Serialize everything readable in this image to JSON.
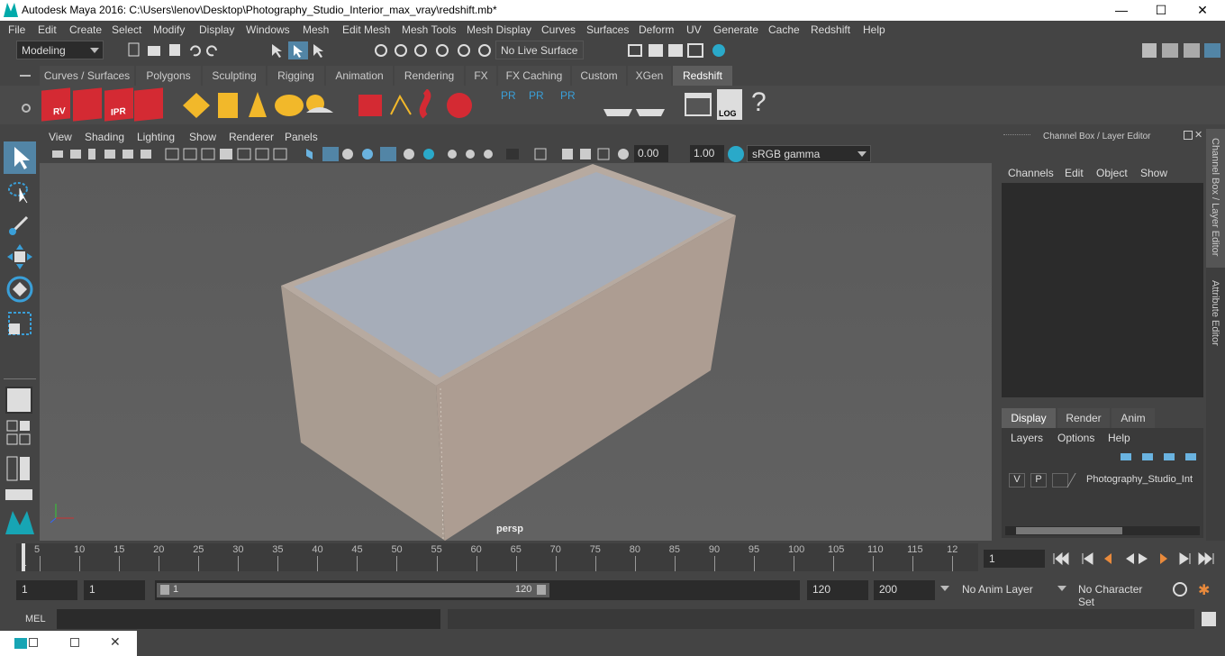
{
  "window": {
    "title": "Autodesk Maya 2016: C:\\Users\\lenov\\Desktop\\Photography_Studio_Interior_max_vray\\redshift.mb*",
    "minimize": "—",
    "maximize": "☐",
    "close": "✕"
  },
  "menu": [
    "File",
    "Edit",
    "Create",
    "Select",
    "Modify",
    "Display",
    "Windows",
    "Mesh",
    "Edit Mesh",
    "Mesh Tools",
    "Mesh Display",
    "Curves",
    "Surfaces",
    "Deform",
    "UV",
    "Generate",
    "Cache",
    "Redshift",
    "Help"
  ],
  "status": {
    "mode": "Modeling",
    "live_surface": "No Live Surface"
  },
  "shelf_tabs": [
    "Curves / Surfaces",
    "Polygons",
    "Sculpting",
    "Rigging",
    "Animation",
    "Rendering",
    "FX",
    "FX Caching",
    "Custom",
    "XGen",
    "Redshift"
  ],
  "shelf_labels": {
    "rv": "RV",
    "ipr": "IPR",
    "pr1": "PR",
    "pr2": "PR",
    "pr3": "PR",
    "log": "LOG",
    "help": "?"
  },
  "viewport": {
    "menu": [
      "View",
      "Shading",
      "Lighting",
      "Show",
      "Renderer",
      "Panels"
    ],
    "exposure": "0.00",
    "gamma": "1.00",
    "colorspace": "sRGB gamma",
    "camera": "persp"
  },
  "channel_box": {
    "title": "Channel Box / Layer Editor",
    "menu": [
      "Channels",
      "Edit",
      "Object",
      "Show"
    ]
  },
  "layer_editor": {
    "tabs": [
      "Display",
      "Render",
      "Anim"
    ],
    "menu": [
      "Layers",
      "Options",
      "Help"
    ],
    "layer": {
      "v": "V",
      "p": "P",
      "name": "Photography_Studio_Int"
    }
  },
  "side_tabs": [
    "Channel Box / Layer Editor",
    "Attribute Editor"
  ],
  "timeline": {
    "ticks": [
      "5",
      "10",
      "15",
      "20",
      "25",
      "30",
      "35",
      "40",
      "45",
      "50",
      "55",
      "60",
      "65",
      "70",
      "75",
      "80",
      "85",
      "90",
      "95",
      "100",
      "105",
      "110",
      "115",
      "12"
    ],
    "start": "1",
    "current": "1"
  },
  "range": {
    "start": "1",
    "anim_start": "1",
    "slider_start": "1",
    "slider_end": "120",
    "end": "120",
    "anim_end": "200",
    "anim_layer": "No Anim Layer",
    "char_set": "No Character Set"
  },
  "cmd": {
    "label": "MEL"
  }
}
